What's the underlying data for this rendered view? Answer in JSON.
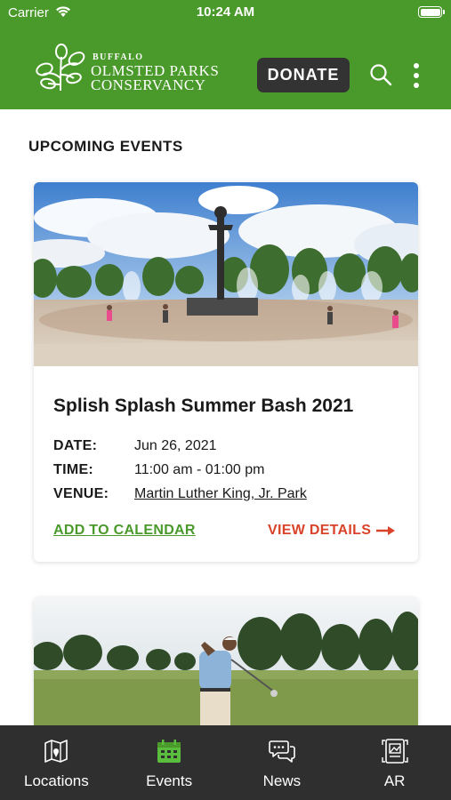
{
  "status_bar": {
    "carrier": "Carrier",
    "time": "10:24 AM"
  },
  "header": {
    "logo_small": "BUFFALO",
    "logo_line1": "OLMSTED PARKS",
    "logo_line2": "CONSERVANCY",
    "donate_label": "DONATE"
  },
  "section_title": "UPCOMING EVENTS",
  "events": [
    {
      "title": "Splish Splash Summer Bash 2021",
      "date_label": "DATE:",
      "date": "Jun 26, 2021",
      "time_label": "TIME:",
      "time": "11:00 am - 01:00 pm",
      "venue_label": "VENUE:",
      "venue": "Martin Luther King, Jr. Park",
      "add_calendar_label": "ADD TO CALENDAR",
      "view_details_label": "VIEW DETAILS"
    }
  ],
  "tabs": [
    {
      "label": "Locations",
      "icon": "map-icon",
      "active": false
    },
    {
      "label": "Events",
      "icon": "calendar-icon",
      "active": true
    },
    {
      "label": "News",
      "icon": "chat-bubbles-icon",
      "active": false
    },
    {
      "label": "AR",
      "icon": "ar-frame-icon",
      "active": false
    }
  ],
  "colors": {
    "brand_green": "#4a9a2b",
    "accent_red": "#d9432a",
    "tab_bar": "#2f2f2f",
    "donate_button": "#333333"
  }
}
